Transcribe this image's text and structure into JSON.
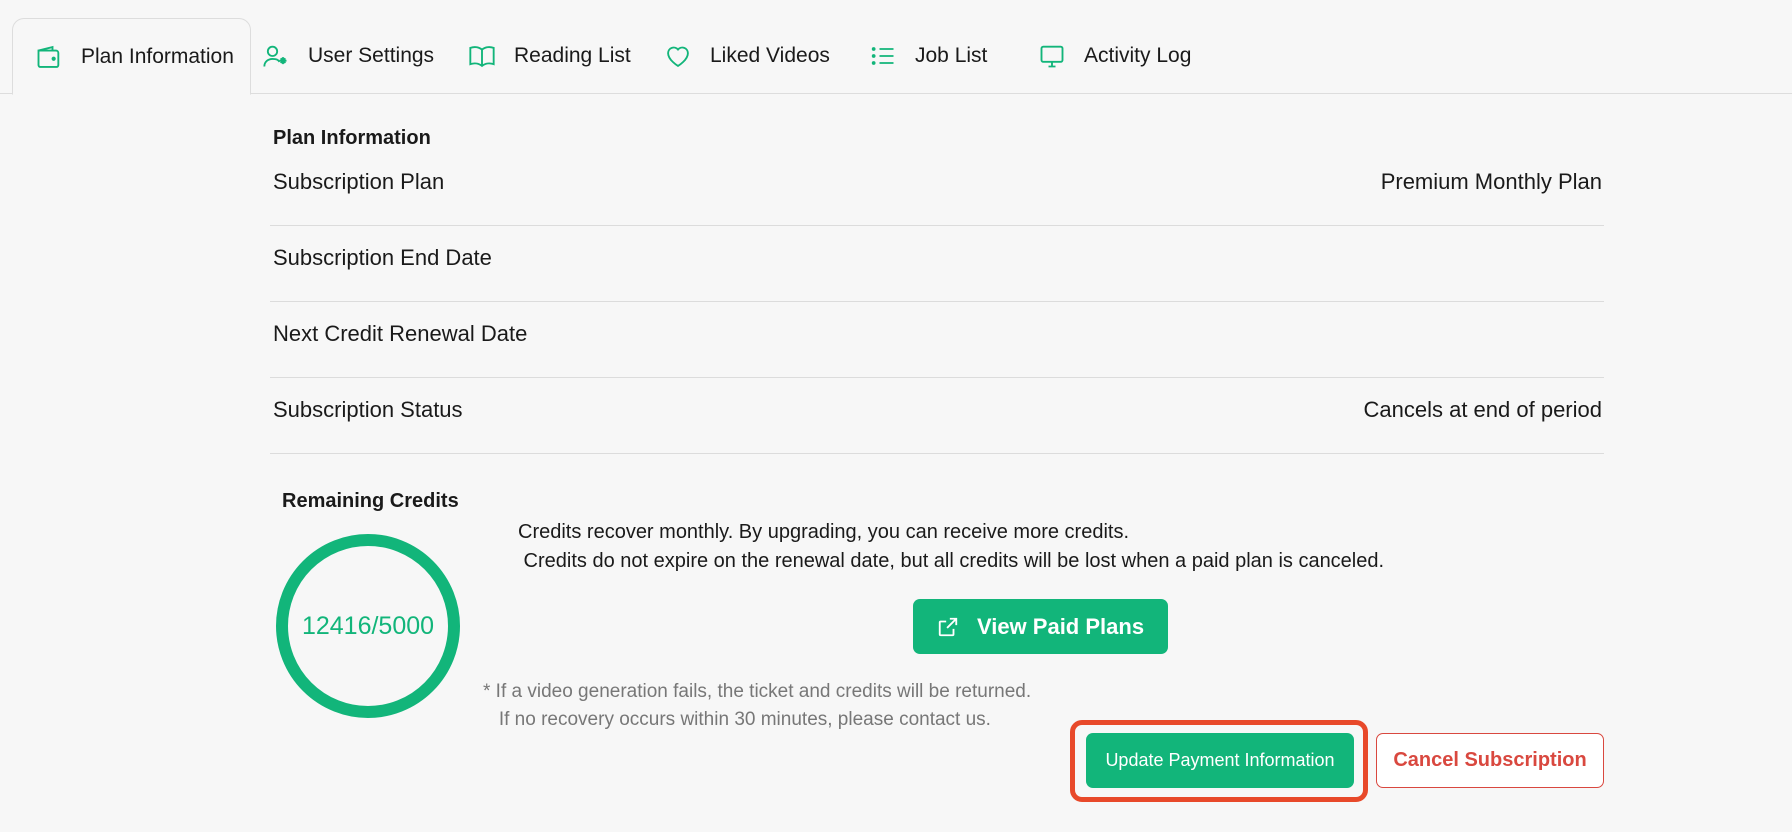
{
  "tabs": [
    {
      "label": "Plan Information",
      "icon": "wallet-icon",
      "active": true
    },
    {
      "label": "User Settings",
      "icon": "user-gear-icon"
    },
    {
      "label": "Reading List",
      "icon": "book-icon"
    },
    {
      "label": "Liked Videos",
      "icon": "heart-icon"
    },
    {
      "label": "Job List",
      "icon": "list-icon"
    },
    {
      "label": "Activity Log",
      "icon": "monitor-icon"
    }
  ],
  "plan": {
    "title": "Plan Information",
    "rows": [
      {
        "label": "Subscription Plan",
        "value": "Premium Monthly Plan"
      },
      {
        "label": "Subscription End Date",
        "value": ""
      },
      {
        "label": "Next Credit Renewal Date",
        "value": ""
      },
      {
        "label": "Subscription Status",
        "value": "Cancels at end of period"
      }
    ]
  },
  "credits": {
    "title": "Remaining Credits",
    "display": "12416/5000",
    "description": "Credits recover monthly. By upgrading, you can receive more credits.\n Credits do not expire on the renewal date, but all credits will be lost when a paid plan is canceled.",
    "view_plans_label": "View Paid Plans",
    "note": "* If a video generation fails, the ticket and credits will be returned.\n   If no recovery occurs within 30 minutes, please contact us."
  },
  "actions": {
    "update_label": "Update Payment Information",
    "cancel_label": "Cancel Subscription"
  },
  "colors": {
    "accent": "#12b57a",
    "danger": "#d9483f",
    "highlight": "#e8492a"
  }
}
